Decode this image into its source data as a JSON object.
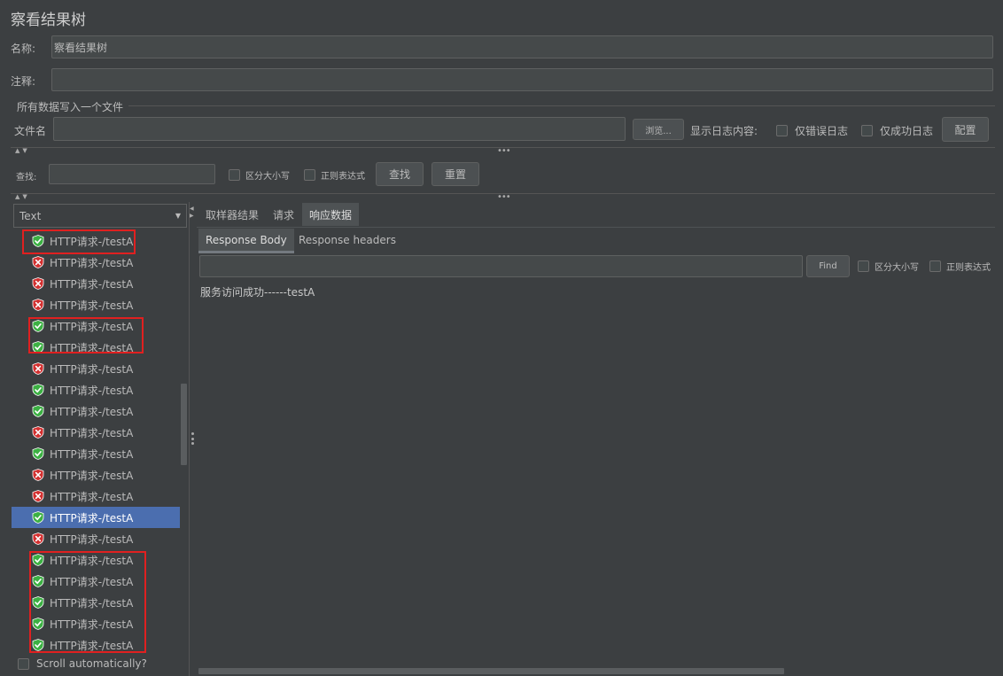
{
  "window": {
    "title": "察看结果树"
  },
  "form": {
    "name_label": "名称:",
    "name_value": "察看结果树",
    "comment_label": "注释:",
    "comment_value": ""
  },
  "file_group": {
    "title": "所有数据写入一个文件",
    "filename_label": "文件名",
    "filename_value": "",
    "browse_label": "浏览...",
    "log_content_label": "显示日志内容:",
    "errors_only_label": "仅错误日志",
    "success_only_label": "仅成功日志",
    "config_label": "配置"
  },
  "search": {
    "label": "查找:",
    "value": "",
    "case_sensitive_label": "区分大小写",
    "regex_label": "正则表达式",
    "find_label": "查找",
    "reset_label": "重置"
  },
  "renderer": {
    "selected": "Text"
  },
  "tree": {
    "items": [
      {
        "label": "HTTP请求-/testA",
        "status": "success"
      },
      {
        "label": "HTTP请求-/testA",
        "status": "error"
      },
      {
        "label": "HTTP请求-/testA",
        "status": "error"
      },
      {
        "label": "HTTP请求-/testA",
        "status": "error"
      },
      {
        "label": "HTTP请求-/testA",
        "status": "success"
      },
      {
        "label": "HTTP请求-/testA",
        "status": "success"
      },
      {
        "label": "HTTP请求-/testA",
        "status": "error"
      },
      {
        "label": "HTTP请求-/testA",
        "status": "success"
      },
      {
        "label": "HTTP请求-/testA",
        "status": "success"
      },
      {
        "label": "HTTP请求-/testA",
        "status": "error"
      },
      {
        "label": "HTTP请求-/testA",
        "status": "success"
      },
      {
        "label": "HTTP请求-/testA",
        "status": "error"
      },
      {
        "label": "HTTP请求-/testA",
        "status": "error"
      },
      {
        "label": "HTTP请求-/testA",
        "status": "success",
        "selected": true
      },
      {
        "label": "HTTP请求-/testA",
        "status": "error"
      },
      {
        "label": "HTTP请求-/testA",
        "status": "success"
      },
      {
        "label": "HTTP请求-/testA",
        "status": "success"
      },
      {
        "label": "HTTP请求-/testA",
        "status": "success"
      },
      {
        "label": "HTTP请求-/testA",
        "status": "success"
      },
      {
        "label": "HTTP请求-/testA",
        "status": "success"
      }
    ],
    "scroll_auto_label": "Scroll automatically?"
  },
  "result_tabs": {
    "sampler_result": "取样器结果",
    "request": "请求",
    "response_data": "响应数据"
  },
  "response_tabs": {
    "body": "Response Body",
    "headers": "Response headers"
  },
  "response_search": {
    "value": "",
    "find_label": "Find",
    "case_sensitive_label": "区分大小写",
    "regex_label": "正则表达式"
  },
  "response_body": "服务访问成功------testA",
  "colors": {
    "background": "#3c3f41",
    "selection": "#4b6eaf",
    "success": "#3cb043",
    "error": "#d23030",
    "highlight_box": "#e02020"
  }
}
